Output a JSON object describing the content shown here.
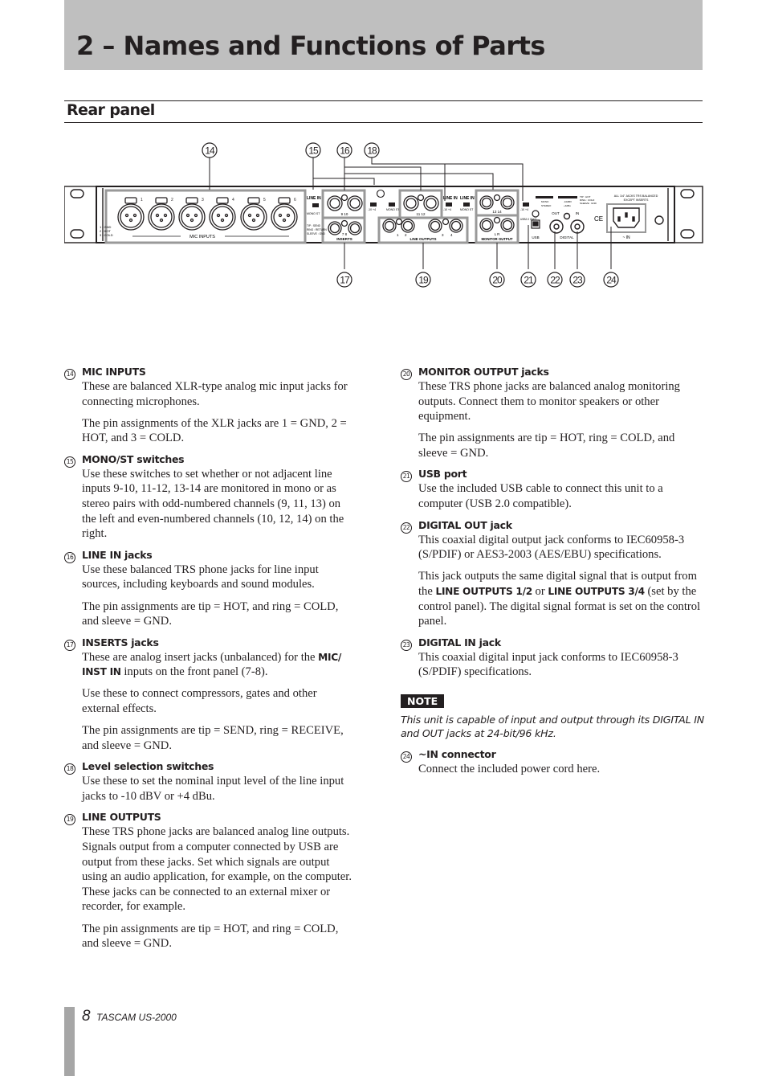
{
  "header": {
    "chapter_title": "2 – Names and Functions of Parts",
    "section_title": "Rear panel"
  },
  "diagram": {
    "callouts": [
      {
        "num": "14",
        "label": "MIC INPUTS"
      },
      {
        "num": "15",
        "label": "MONO/ST switches"
      },
      {
        "num": "16",
        "label": "LINE IN jacks"
      },
      {
        "num": "17",
        "label": "INSERTS jacks"
      },
      {
        "num": "18",
        "label": "Level selection switches"
      },
      {
        "num": "19",
        "label": "LINE OUTPUTS"
      },
      {
        "num": "20",
        "label": "MONITOR OUTPUT jacks"
      },
      {
        "num": "21",
        "label": "USB port"
      },
      {
        "num": "22",
        "label": "DIGITAL OUT jack"
      },
      {
        "num": "23",
        "label": "DIGITAL IN jack"
      },
      {
        "num": "24",
        "label": "~IN connector"
      }
    ],
    "panel_labels": {
      "mic_inputs": "MIC INPUTS",
      "mic_numbers": [
        "1",
        "2",
        "3",
        "4",
        "5",
        "6"
      ],
      "xlr_pins": [
        "1 : GND",
        "2 : HOT",
        "3 : COLD"
      ],
      "line_in": "LINE IN",
      "mono_st": "MONO ST",
      "level": "-10  +4",
      "ch_9_10": "9  10",
      "ch_11_12": "11  12",
      "ch_13_14": "13  14",
      "inserts": "INSERTS",
      "inserts_ch": "7  8",
      "inserts_pins": [
        "TIP : SEND",
        "RING : RETURN",
        "SLEEVE : GND"
      ],
      "line_outputs": "LINE OUTPUTS",
      "line_out_nums": [
        "1",
        "2",
        "3",
        "4"
      ],
      "monitor_output": "MONITOR OUTPUT",
      "monitor_lr": "L   R",
      "usb": "USB",
      "usb_note": "USB2.0 ONLY",
      "digital": "DIGITAL",
      "digital_out": "OUT",
      "digital_in": "IN",
      "mono_legend": [
        "MONO",
        "STEREO"
      ],
      "level_legend": [
        "-10dBV",
        "+4dBu"
      ],
      "trs_pins": [
        "TIP : HOT",
        "RING : COLD",
        "SLEEVE : GND"
      ],
      "balanced_note": [
        "ALL 1/4\" JACKS TRS BALANCED",
        "EXCEPT INSERTS"
      ],
      "power_in": "~ IN",
      "ce": "CE"
    }
  },
  "items_left": [
    {
      "num": "14",
      "title": "MIC INPUTS",
      "paras": [
        "These are balanced XLR-type analog mic input jacks for connecting microphones.",
        "The pin assignments of the XLR jacks are 1 = GND, 2 = HOT, and 3 = COLD."
      ]
    },
    {
      "num": "15",
      "title": "MONO/ST switches",
      "paras": [
        "Use these switches to set whether or not adjacent line inputs 9-10, 11-12, 13-14 are monitored in mono or as stereo pairs with odd-numbered channels (9, 11, 13) on the left and even-numbered channels (10, 12, 14) on the right."
      ]
    },
    {
      "num": "16",
      "title": "LINE IN jacks",
      "paras": [
        "Use these balanced TRS phone jacks for line input sources, including keyboards and sound modules.",
        "The pin assignments are tip = HOT, and ring = COLD, and sleeve = GND."
      ]
    },
    {
      "num": "17",
      "title": "INSERTS jacks",
      "para1_pre": "These are analog insert jacks (unbalanced) for the ",
      "para1_bold": "MIC/ INST IN",
      "para1_post": " inputs on the front panel (7-8).",
      "paras": [
        "Use these to connect compressors, gates and other external effects.",
        "The pin assignments are tip = SEND, ring = RECEIVE, and sleeve = GND."
      ]
    },
    {
      "num": "18",
      "title": "Level selection switches",
      "paras": [
        "Use these to set the nominal input level of the line input jacks to -10 dBV or +4 dBu."
      ]
    },
    {
      "num": "19",
      "title": "LINE OUTPUTS",
      "paras": [
        "These TRS phone jacks are balanced analog line outputs. Signals output from a computer connected by USB are output from these jacks. Set which signals are output using an audio application, for example, on the computer. These jacks can be connected to an external mixer or recorder, for example.",
        "The pin assignments are tip = HOT, and ring = COLD, and sleeve = GND."
      ]
    }
  ],
  "items_right": [
    {
      "num": "20",
      "title": "MONITOR OUTPUT jacks",
      "paras": [
        "These TRS phone jacks are balanced analog monitoring outputs. Connect them to monitor speakers or other equipment.",
        "The pin assignments are tip = HOT, ring = COLD, and sleeve = GND."
      ]
    },
    {
      "num": "21",
      "title": "USB port",
      "paras": [
        "Use the included USB cable to connect this unit to a computer (USB 2.0 compatible)."
      ]
    },
    {
      "num": "22",
      "title": "DIGITAL OUT jack",
      "paras": [
        "This coaxial digital output jack conforms to IEC60958-3 (S/PDIF) or AES3-2003 (AES/EBU) specifications."
      ],
      "para2_pre": "This jack outputs the same digital signal that is output from the ",
      "para2_bold1": "LINE OUTPUTS 1/2",
      "para2_mid": " or ",
      "para2_bold2": "LINE OUTPUTS 3/4",
      "para2_post": " (set by the control panel). The digital signal format is set on the control panel."
    },
    {
      "num": "23",
      "title": "DIGITAL IN jack",
      "paras": [
        "This coaxial digital input jack conforms to IEC60958-3 (S/PDIF) specifications."
      ]
    },
    {
      "num": "24",
      "title": "~IN connector",
      "paras": [
        "Connect the included power cord here."
      ]
    }
  ],
  "note": {
    "badge": "NOTE",
    "text": "This unit is capable of input and output through its DIGITAL IN and OUT jacks at 24-bit/96 kHz."
  },
  "footer": {
    "page_number": "8",
    "brand": "TASCAM  US-2000"
  }
}
